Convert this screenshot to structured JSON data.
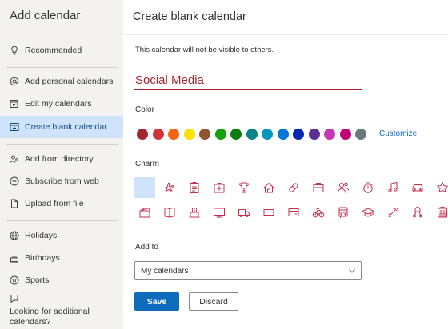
{
  "sidebar": {
    "title": "Add calendar",
    "items": [
      {
        "label": "Recommended",
        "icon": "lightbulb-icon"
      },
      {
        "label": "Add personal calendars",
        "icon": "at-sign-icon"
      },
      {
        "label": "Edit my calendars",
        "icon": "edit-calendar-icon"
      },
      {
        "label": "Create blank calendar",
        "icon": "calendar-add-icon",
        "active": true
      },
      {
        "label": "Add from directory",
        "icon": "people-search-icon"
      },
      {
        "label": "Subscribe from web",
        "icon": "link-icon"
      },
      {
        "label": "Upload from file",
        "icon": "document-icon"
      },
      {
        "label": "Holidays",
        "icon": "globe-icon"
      },
      {
        "label": "Birthdays",
        "icon": "cake-icon"
      },
      {
        "label": "Sports",
        "icon": "soccer-ball-icon"
      }
    ],
    "more_label": "Looking for additional calendars?"
  },
  "main": {
    "title": "Create blank calendar",
    "subtitle": "This calendar will not be visible to others.",
    "name_value": "Social Media",
    "color_label": "Color",
    "colors": [
      "#a4262c",
      "#d13438",
      "#f7630c",
      "#fce100",
      "#8e562e",
      "#13a10e",
      "#107c10",
      "#038387",
      "#0099bc",
      "#0078d4",
      "#0027b4",
      "#5c2e91",
      "#c239b3",
      "#bf0077",
      "#69797e"
    ],
    "customize_label": "Customize",
    "charm_label": "Charm",
    "charm_color": "#c4314b",
    "charms": [
      "none",
      "airplane-icon",
      "clipboard-icon",
      "first-aid-icon",
      "trophy-icon",
      "home-icon",
      "pill-icon",
      "briefcase-icon",
      "people-icon",
      "timer-icon",
      "music-note-icon",
      "car-icon",
      "star-icon",
      "clapperboard-icon",
      "book-icon",
      "birthday-cake-icon",
      "monitor-icon",
      "truck-icon",
      "ticket-icon",
      "card-icon",
      "bicycle-icon",
      "bus-icon",
      "graduation-cap-icon",
      "dumbbell-icon",
      "scooter-icon",
      "building-icon"
    ],
    "add_to_label": "Add to",
    "add_to_value": "My calendars",
    "save_label": "Save",
    "discard_label": "Discard"
  }
}
